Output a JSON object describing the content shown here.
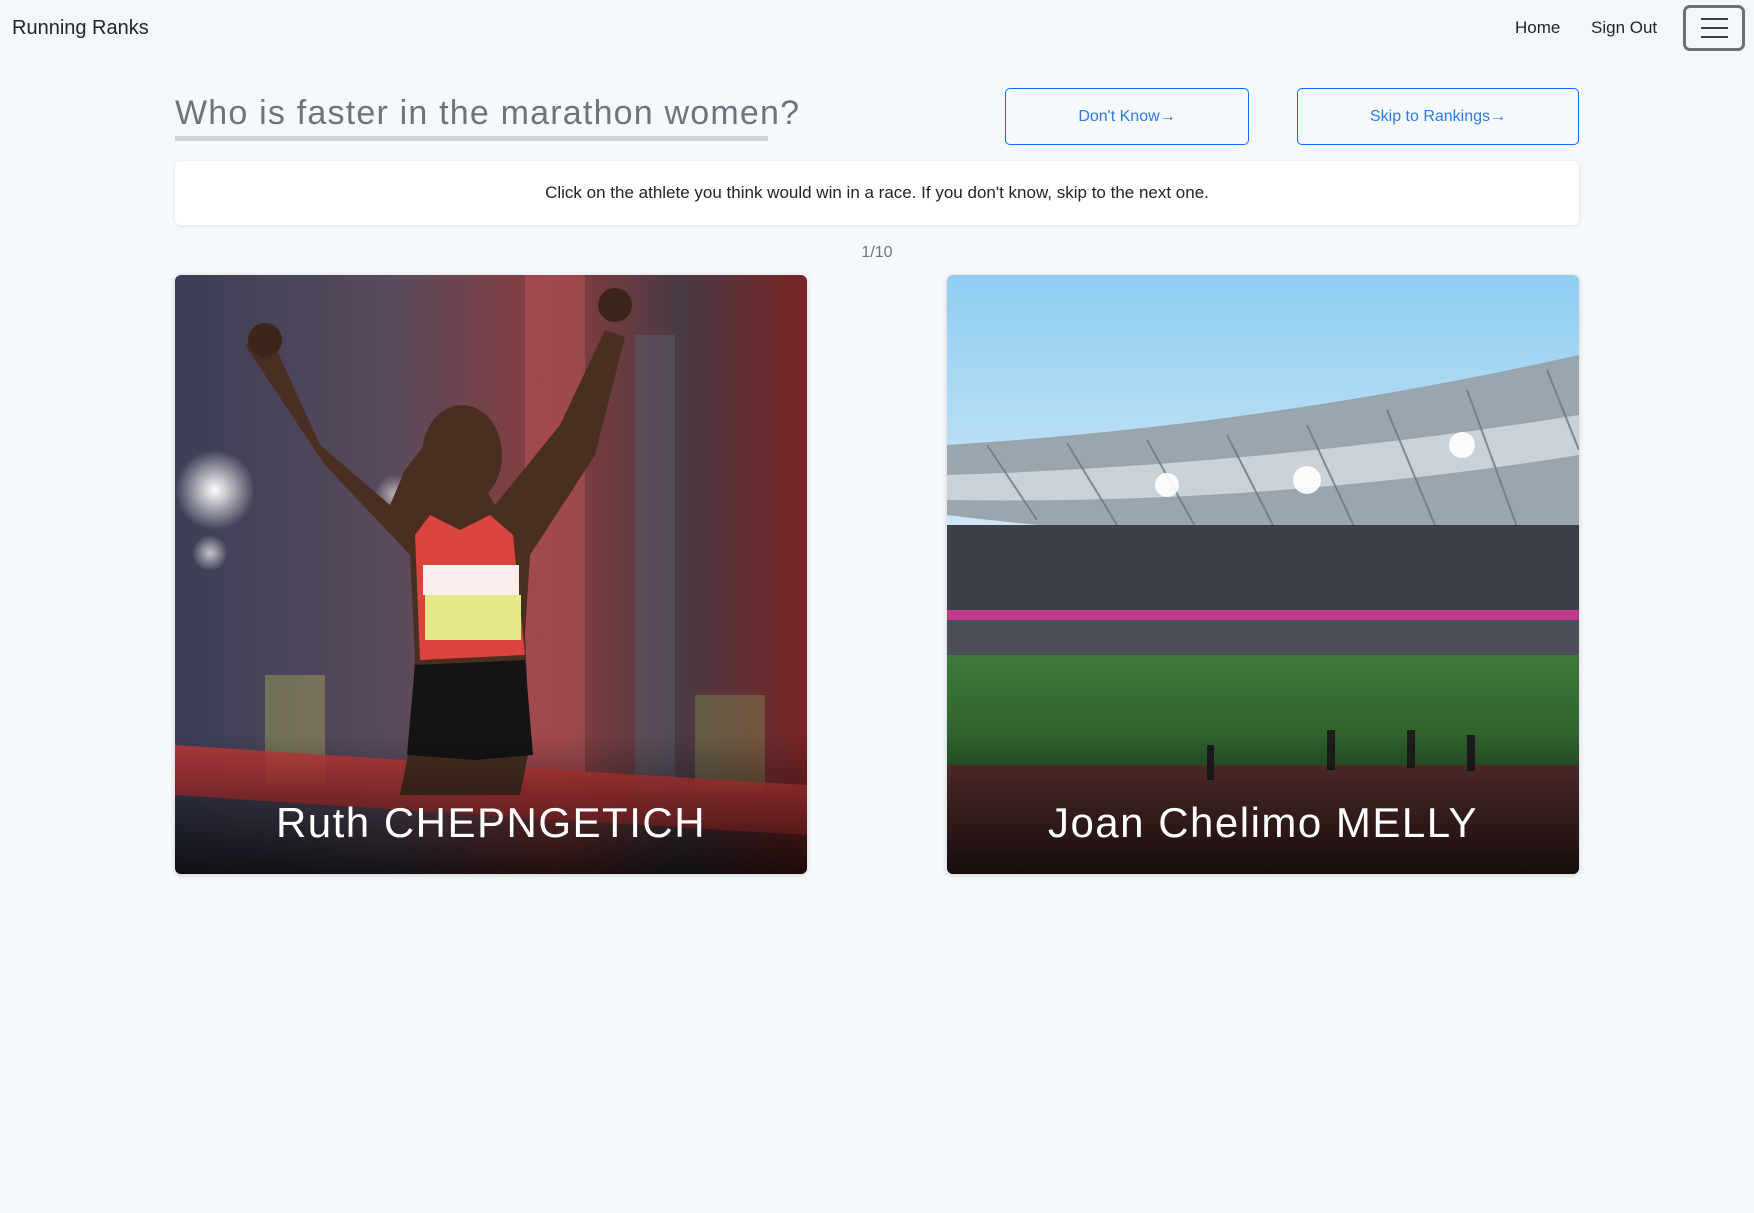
{
  "navbar": {
    "brand": "Running Ranks",
    "links": [
      {
        "label": "Home"
      },
      {
        "label": "Sign Out"
      }
    ],
    "menu_icon": "hamburger-menu-icon"
  },
  "header": {
    "question": "Who is faster in the marathon women?",
    "dont_know_label": "Don't Know→",
    "skip_label": "Skip to Rankings→"
  },
  "instructions": "Click on the athlete you think would win in a race. If you don't know, skip to the next one.",
  "progress": "1/10",
  "athletes": [
    {
      "name": "Ruth CHEPNGETICH",
      "photo": "athlete-celebrating-photo"
    },
    {
      "name": "Joan Chelimo MELLY",
      "photo": "stadium-photo"
    }
  ],
  "colors": {
    "background": "#f6f9fc",
    "accent": "#0d6efd",
    "muted": "#6c757d"
  }
}
